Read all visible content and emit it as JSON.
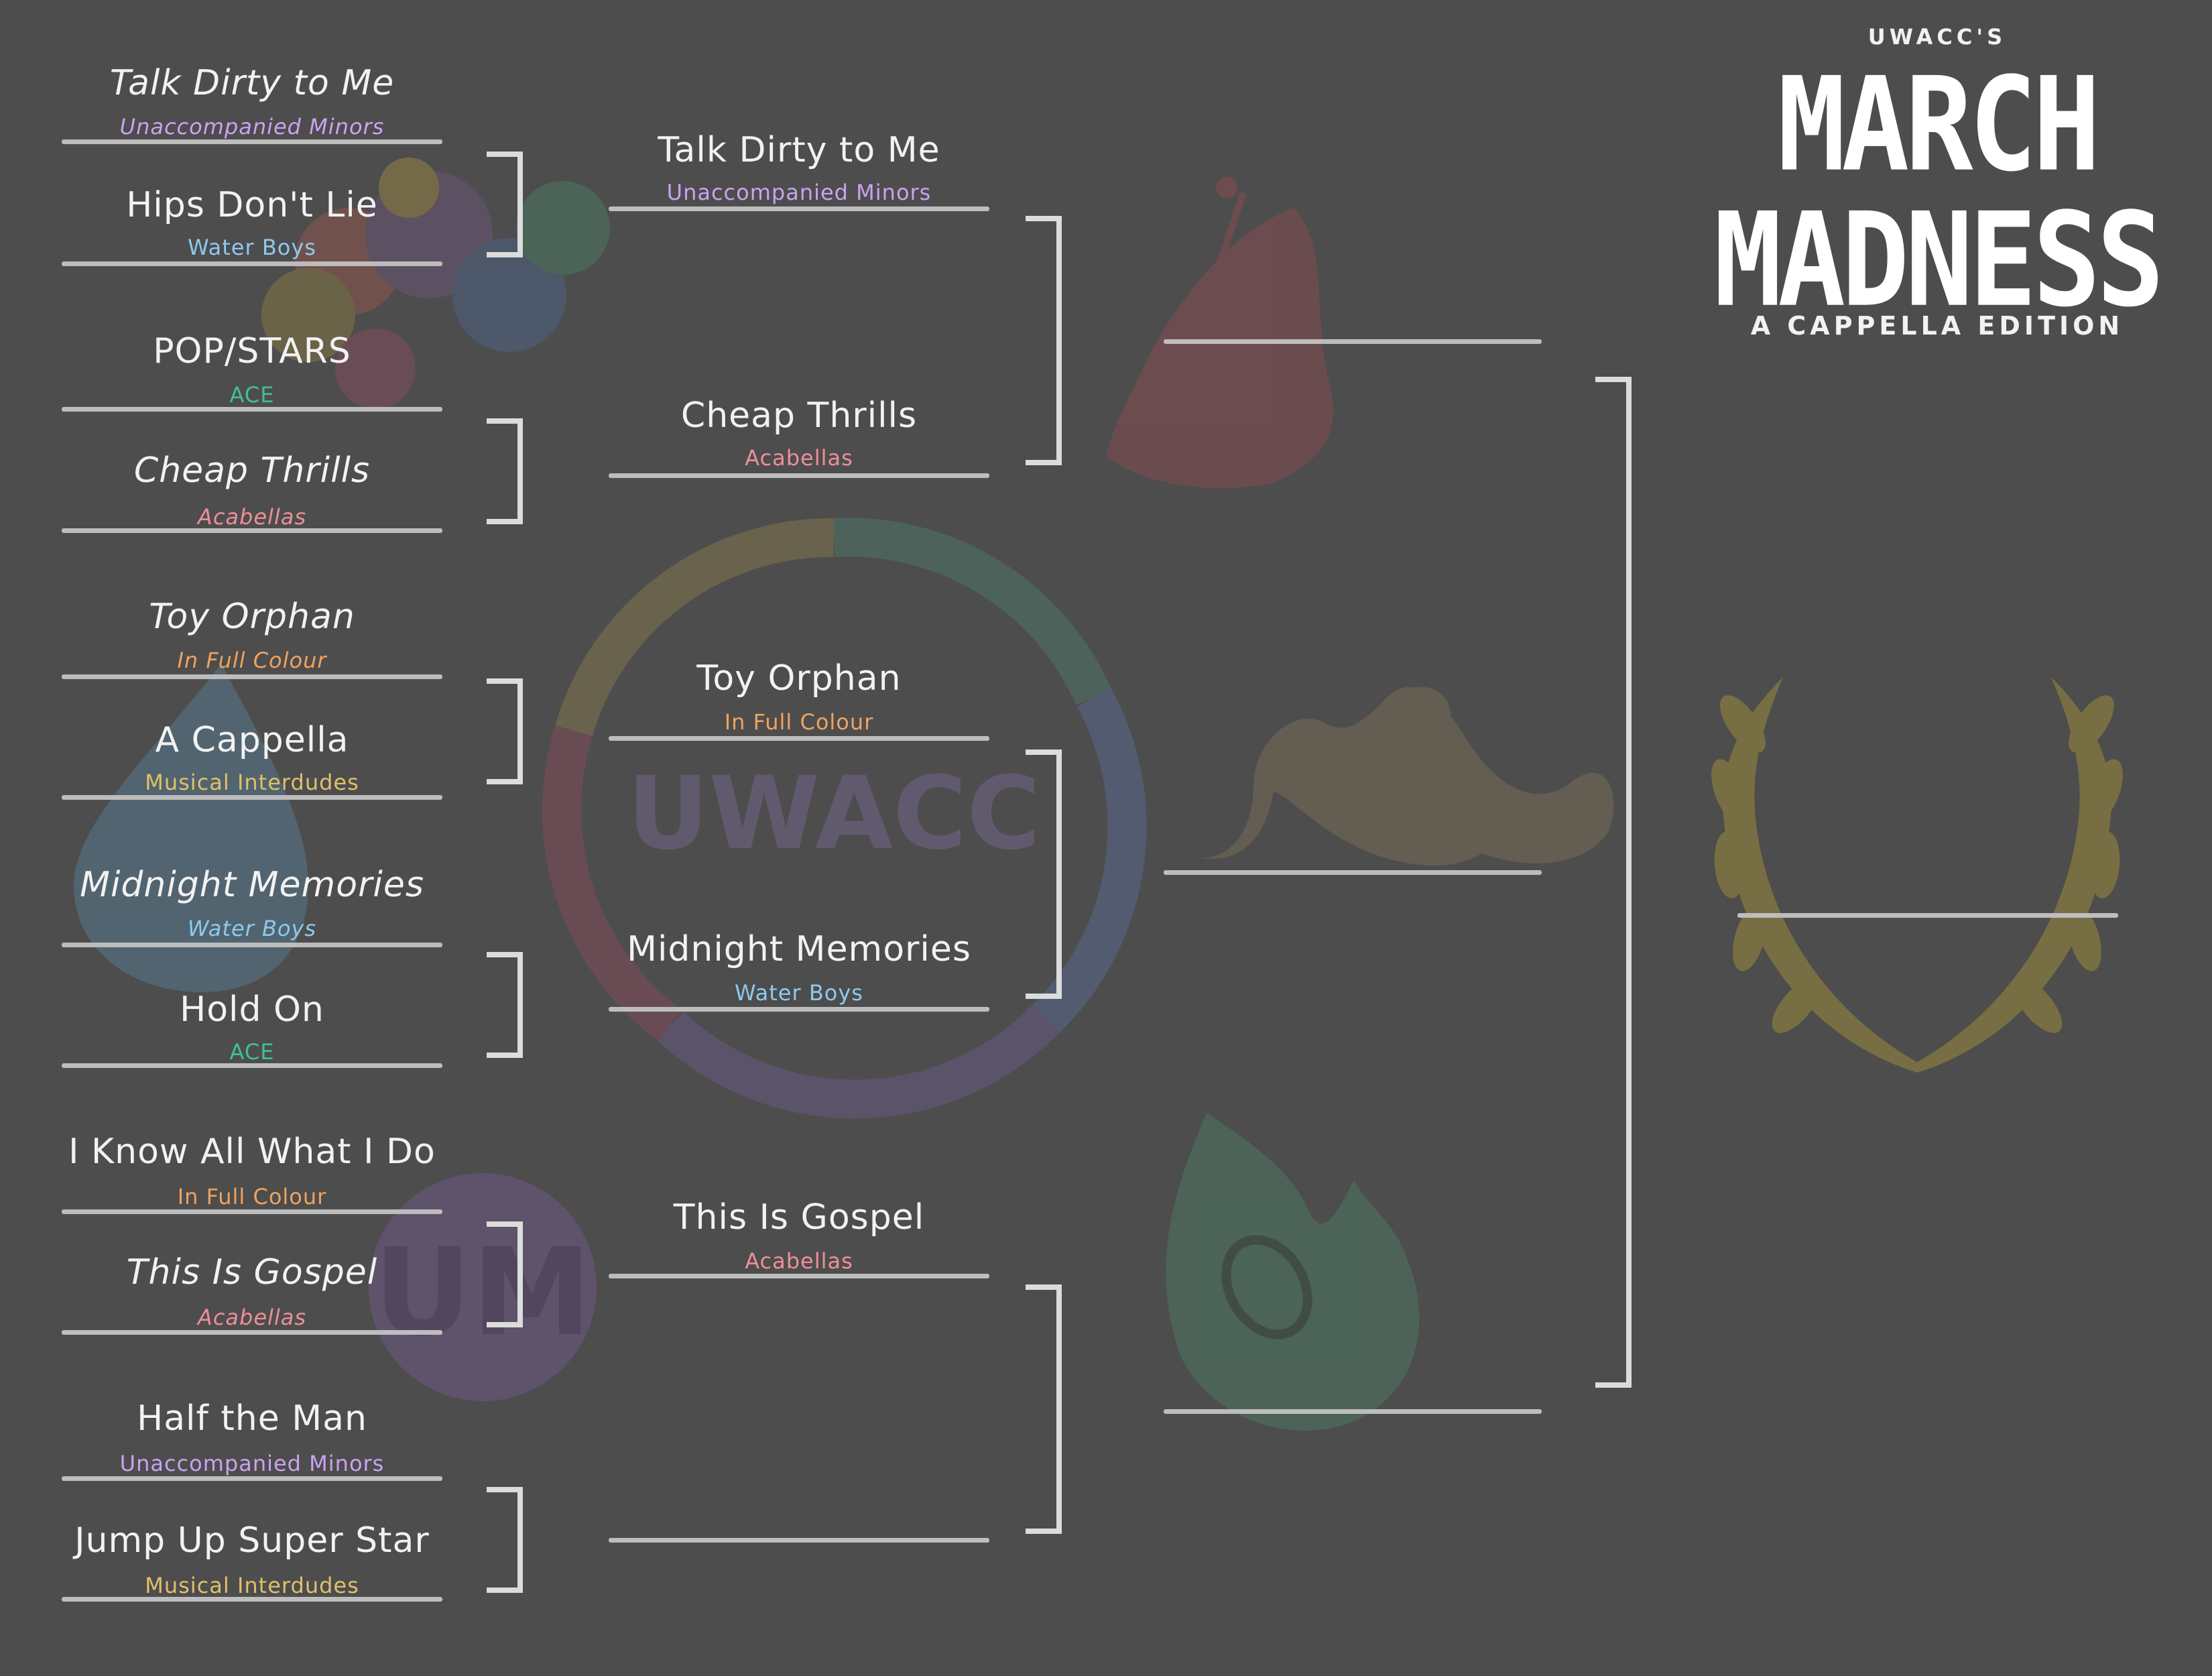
{
  "header": {
    "org": "UWACC'S",
    "line1": "MARCH",
    "line2": "MADNESS",
    "subtitle": "A CAPPELLA EDITION"
  },
  "watermark": {
    "logo_text": "UWACC",
    "mic_badge_text": "UM"
  },
  "group_colors": {
    "Unaccompanied Minors": "#c9a3f0",
    "Water Boys": "#8ec9ee",
    "ACE": "#3fbf96",
    "Acabellas": "#ee8f98",
    "In Full Colour": "#f0a260",
    "Musical Interdudes": "#e0c06a"
  },
  "round1": [
    {
      "song": "Talk Dirty to Me",
      "group": "Unaccompanied Minors",
      "winner": true
    },
    {
      "song": "Hips Don't Lie",
      "group": "Water Boys",
      "winner": false
    },
    {
      "song": "POP/STARS",
      "group": "ACE",
      "winner": false
    },
    {
      "song": "Cheap Thrills",
      "group": "Acabellas",
      "winner": true
    },
    {
      "song": "Toy Orphan",
      "group": "In Full Colour",
      "winner": true
    },
    {
      "song": "A Cappella",
      "group": "Musical Interdudes",
      "winner": false
    },
    {
      "song": "Midnight Memories",
      "group": "Water Boys",
      "winner": true
    },
    {
      "song": "Hold On",
      "group": "ACE",
      "winner": false
    },
    {
      "song": "I Know All What I Do",
      "group": "In Full Colour",
      "winner": false
    },
    {
      "song": "This Is Gospel",
      "group": "Acabellas",
      "winner": true
    },
    {
      "song": "Half the Man",
      "group": "Unaccompanied Minors",
      "winner": false
    },
    {
      "song": "Jump Up Super Star",
      "group": "Musical Interdudes",
      "winner": false
    }
  ],
  "round2": [
    {
      "song": "Talk Dirty to Me",
      "group": "Unaccompanied Minors"
    },
    {
      "song": "Cheap Thrills",
      "group": "Acabellas"
    },
    {
      "song": "Toy Orphan",
      "group": "In Full Colour"
    },
    {
      "song": "Midnight Memories",
      "group": "Water Boys"
    },
    {
      "song": "This Is Gospel",
      "group": "Acabellas"
    },
    {
      "song": "",
      "group": ""
    }
  ],
  "round3": [
    {
      "song": "",
      "group": ""
    },
    {
      "song": "",
      "group": ""
    },
    {
      "song": "",
      "group": ""
    }
  ],
  "champion": {
    "song": "",
    "group": ""
  }
}
